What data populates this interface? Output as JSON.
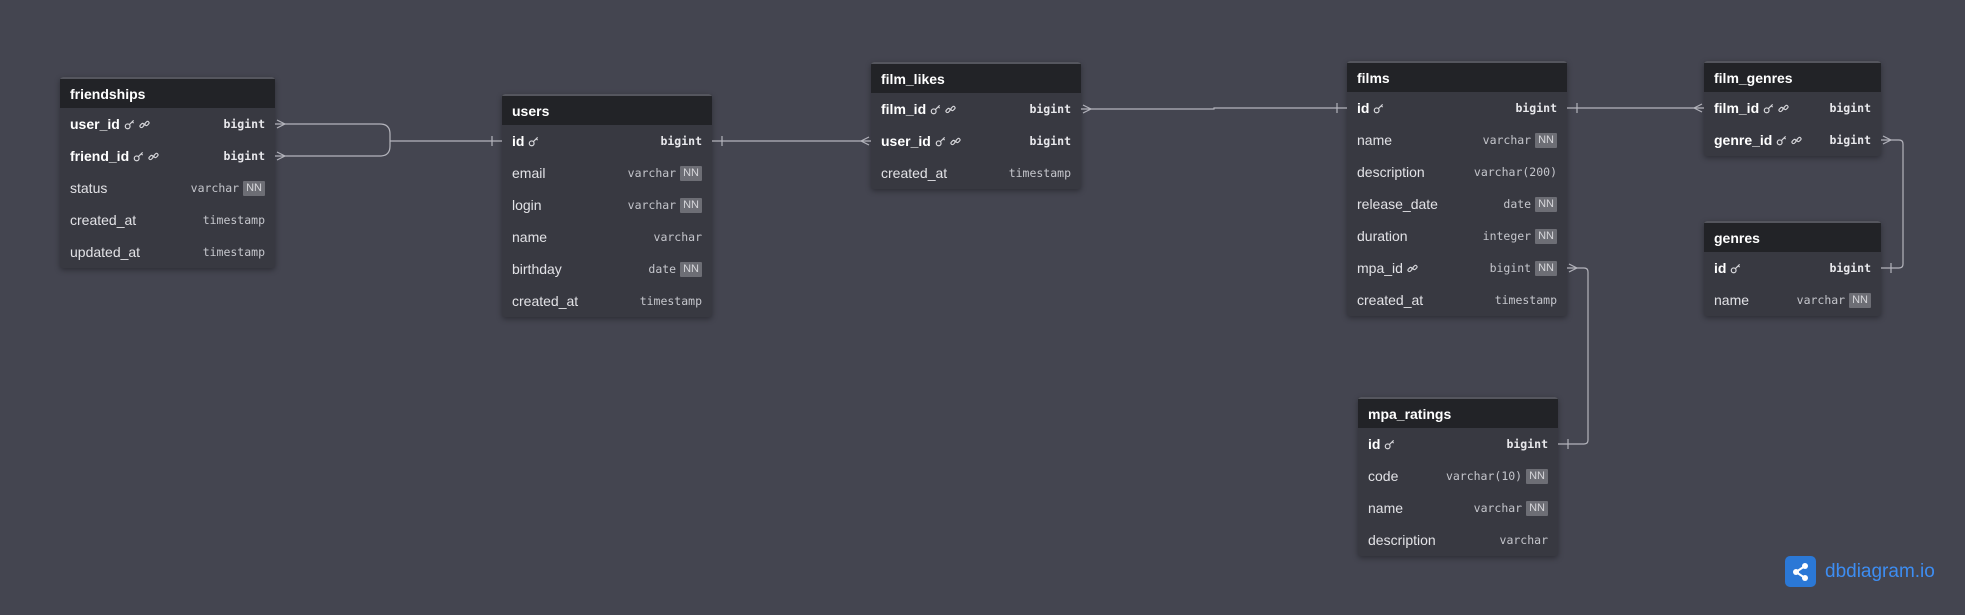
{
  "tables": [
    {
      "key": "friendships",
      "name": "friendships",
      "fields": [
        {
          "name": "user_id",
          "type": "bigint",
          "nn": false,
          "pk": false,
          "fk": true,
          "bold": true,
          "key_icon": true
        },
        {
          "name": "friend_id",
          "type": "bigint",
          "nn": false,
          "pk": false,
          "fk": true,
          "bold": true,
          "key_icon": true
        },
        {
          "name": "status",
          "type": "varchar",
          "nn": true
        },
        {
          "name": "created_at",
          "type": "timestamp",
          "nn": false
        },
        {
          "name": "updated_at",
          "type": "timestamp",
          "nn": false
        }
      ]
    },
    {
      "key": "users",
      "name": "users",
      "fields": [
        {
          "name": "id",
          "type": "bigint",
          "nn": false,
          "pk": true,
          "key_icon": true
        },
        {
          "name": "email",
          "type": "varchar",
          "nn": true
        },
        {
          "name": "login",
          "type": "varchar",
          "nn": true
        },
        {
          "name": "name",
          "type": "varchar",
          "nn": false
        },
        {
          "name": "birthday",
          "type": "date",
          "nn": true
        },
        {
          "name": "created_at",
          "type": "timestamp",
          "nn": false
        }
      ]
    },
    {
      "key": "film_likes",
      "name": "film_likes",
      "fields": [
        {
          "name": "film_id",
          "type": "bigint",
          "nn": false,
          "fk": true,
          "bold": true,
          "key_icon": true
        },
        {
          "name": "user_id",
          "type": "bigint",
          "nn": false,
          "fk": true,
          "bold": true,
          "key_icon": true
        },
        {
          "name": "created_at",
          "type": "timestamp",
          "nn": false
        }
      ]
    },
    {
      "key": "films",
      "name": "films",
      "fields": [
        {
          "name": "id",
          "type": "bigint",
          "nn": false,
          "pk": true,
          "key_icon": true
        },
        {
          "name": "name",
          "type": "varchar",
          "nn": true
        },
        {
          "name": "description",
          "type": "varchar(200)",
          "nn": false
        },
        {
          "name": "release_date",
          "type": "date",
          "nn": true
        },
        {
          "name": "duration",
          "type": "integer",
          "nn": true
        },
        {
          "name": "mpa_id",
          "type": "bigint",
          "nn": true,
          "fk": true
        },
        {
          "name": "created_at",
          "type": "timestamp",
          "nn": false
        }
      ]
    },
    {
      "key": "film_genres",
      "name": "film_genres",
      "fields": [
        {
          "name": "film_id",
          "type": "bigint",
          "nn": false,
          "fk": true,
          "bold": true,
          "key_icon": true
        },
        {
          "name": "genre_id",
          "type": "bigint",
          "nn": false,
          "fk": true,
          "bold": true,
          "key_icon": true
        }
      ]
    },
    {
      "key": "genres",
      "name": "genres",
      "fields": [
        {
          "name": "id",
          "type": "bigint",
          "nn": false,
          "pk": true,
          "key_icon": true
        },
        {
          "name": "name",
          "type": "varchar",
          "nn": true
        }
      ]
    },
    {
      "key": "mpa_ratings",
      "name": "mpa_ratings",
      "fields": [
        {
          "name": "id",
          "type": "bigint",
          "nn": false,
          "pk": true,
          "key_icon": true
        },
        {
          "name": "code",
          "type": "varchar(10)",
          "nn": true
        },
        {
          "name": "name",
          "type": "varchar",
          "nn": true
        },
        {
          "name": "description",
          "type": "varchar",
          "nn": false
        }
      ]
    }
  ],
  "nn_label": "NN",
  "relationships": [
    {
      "from": "friendships.user_id",
      "to": "users.id",
      "from_card": "many",
      "to_card": "one"
    },
    {
      "from": "friendships.friend_id",
      "to": "users.id",
      "from_card": "many",
      "to_card": "one"
    },
    {
      "from": "film_likes.user_id",
      "to": "users.id",
      "from_card": "many",
      "to_card": "one"
    },
    {
      "from": "film_likes.film_id",
      "to": "films.id",
      "from_card": "many",
      "to_card": "one"
    },
    {
      "from": "film_genres.film_id",
      "to": "films.id",
      "from_card": "many",
      "to_card": "one"
    },
    {
      "from": "film_genres.genre_id",
      "to": "genres.id",
      "from_card": "many",
      "to_card": "one"
    },
    {
      "from": "films.mpa_id",
      "to": "mpa_ratings.id",
      "from_card": "many",
      "to_card": "one"
    }
  ],
  "brand": {
    "name": "dbdiagram.io",
    "icon": "share-icon"
  },
  "colors": {
    "background": "#444550",
    "table_header": "#222327",
    "table_body": "#383941",
    "line": "#b4b4bc",
    "brand": "#3d8df2"
  }
}
